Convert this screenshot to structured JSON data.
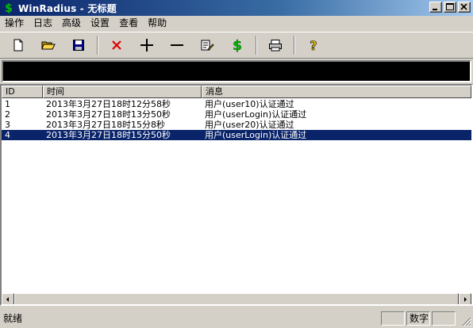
{
  "window": {
    "title": "WinRadius - 无标题",
    "colors": {
      "titlebar": "#0a246a",
      "selection": "#0a246a",
      "face": "#d4d0c8"
    }
  },
  "menu": [
    "操作",
    "日志",
    "高级",
    "设置",
    "查看",
    "帮助"
  ],
  "toolbar": {
    "tools": [
      {
        "name": "new-document-icon"
      },
      {
        "name": "open-folder-icon"
      },
      {
        "name": "save-disk-icon"
      },
      {
        "name": "delete-x-icon"
      },
      {
        "name": "add-plus-icon"
      },
      {
        "name": "remove-minus-icon"
      },
      {
        "name": "edit-pencil-icon"
      },
      {
        "name": "dollar-icon"
      },
      {
        "name": "print-icon"
      },
      {
        "name": "help-question-icon"
      }
    ]
  },
  "list": {
    "columns": [
      "ID",
      "时间",
      "消息"
    ],
    "rows": [
      {
        "id": "1",
        "time": "2013年3月27日18时12分58秒",
        "msg": "用户(user10)认证通过",
        "selected": false
      },
      {
        "id": "2",
        "time": "2013年3月27日18时13分50秒",
        "msg": "用户(userLogin)认证通过",
        "selected": false
      },
      {
        "id": "3",
        "time": "2013年3月27日18时15分8秒",
        "msg": "用户(user20)认证通过",
        "selected": false
      },
      {
        "id": "4",
        "time": "2013年3月27日18时15分50秒",
        "msg": "用户(userLogin)认证通过",
        "selected": true
      }
    ]
  },
  "status": {
    "text": "就绪",
    "panels": [
      "",
      "数字",
      ""
    ]
  }
}
